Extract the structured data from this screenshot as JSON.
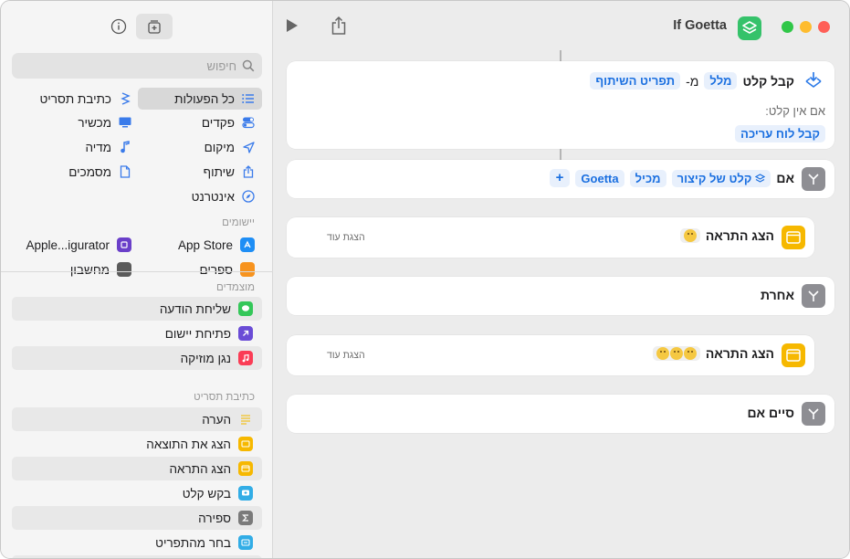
{
  "window": {
    "title": "If Goetta",
    "traffic_lights": [
      "#30c748",
      "#febc2e",
      "#ff5f57"
    ]
  },
  "toolbar": {
    "run_icon": "play-icon",
    "share_icon": "share-icon",
    "info_icon": "info-icon",
    "library_icon": "library-add-icon"
  },
  "sidebar": {
    "search_placeholder": "חיפוש",
    "categories": [
      {
        "label": "כל הפעולות",
        "icon": "list-icon"
      },
      {
        "label": "כתיבת תסריט",
        "icon": "scripting-icon"
      },
      {
        "label": "פקדים",
        "icon": "toggle-icon"
      },
      {
        "label": "מכשיר",
        "icon": "display-icon"
      },
      {
        "label": "מיקום",
        "icon": "location-arrow-icon"
      },
      {
        "label": "מדיה",
        "icon": "music-note-icon"
      },
      {
        "label": "שיתוף",
        "icon": "share-icon"
      },
      {
        "label": "מסמכים",
        "icon": "document-icon"
      },
      {
        "label": "אינטרנט",
        "icon": "compass-icon"
      }
    ],
    "apps_title": "יישומים",
    "apps": [
      {
        "label": "App Store",
        "icon": "app-store-icon"
      },
      {
        "label": "Apple...igurator",
        "icon": "configurator-icon"
      },
      {
        "label": "ספרים",
        "icon": "books-icon"
      },
      {
        "label": "מחשבון",
        "icon": "calculator-icon"
      }
    ],
    "suggested_title": "מוצמדים",
    "suggested": [
      {
        "label": "שליחת הודעה",
        "icon": "messages-icon",
        "color": "#34c759"
      },
      {
        "label": "פתיחת יישום",
        "icon": "open-app-icon",
        "color": "#6a4cd6"
      },
      {
        "label": "נגן מוזיקה",
        "icon": "music-icon",
        "color": "#fa3c55"
      }
    ],
    "scripting_title": "כתיבת תסריט",
    "scripting": [
      {
        "label": "הערה",
        "icon": "comment-lines-icon",
        "color": "#f6d04d"
      },
      {
        "label": "הצג את התוצאה",
        "icon": "show-result-icon",
        "color": "#f6b800"
      },
      {
        "label": "הצג התראה",
        "icon": "alert-icon",
        "color": "#f6b800"
      },
      {
        "label": "בקש קלט",
        "icon": "ask-input-icon",
        "color": "#32ade6"
      },
      {
        "label": "ספירה",
        "icon": "sigma-icon",
        "color": "#7a7a7a"
      },
      {
        "label": "בחר מהתפריט",
        "icon": "menu-icon",
        "color": "#32ade6"
      }
    ]
  },
  "editor": {
    "receive": {
      "label": "קבל קלט",
      "from_token": "מלל",
      "from_sep": "מ-",
      "source_token": "תפריט השיתוף",
      "no_input_label": "אם אין קלט:",
      "no_input_token": "קבל לוח עריכה"
    },
    "if_block": {
      "label": "אם",
      "var_token": "קלט של קיצור",
      "cond_token": "מכיל",
      "value_token": "Goetta",
      "add": "+"
    },
    "alert1": {
      "label": "הצג התראה",
      "show_more": "הצגת עוד"
    },
    "otherwise": {
      "label": "אחרת"
    },
    "alert2": {
      "label": "הצג התראה",
      "show_more": "הצגת עוד"
    },
    "end_if": {
      "label": "סיים אם"
    }
  }
}
